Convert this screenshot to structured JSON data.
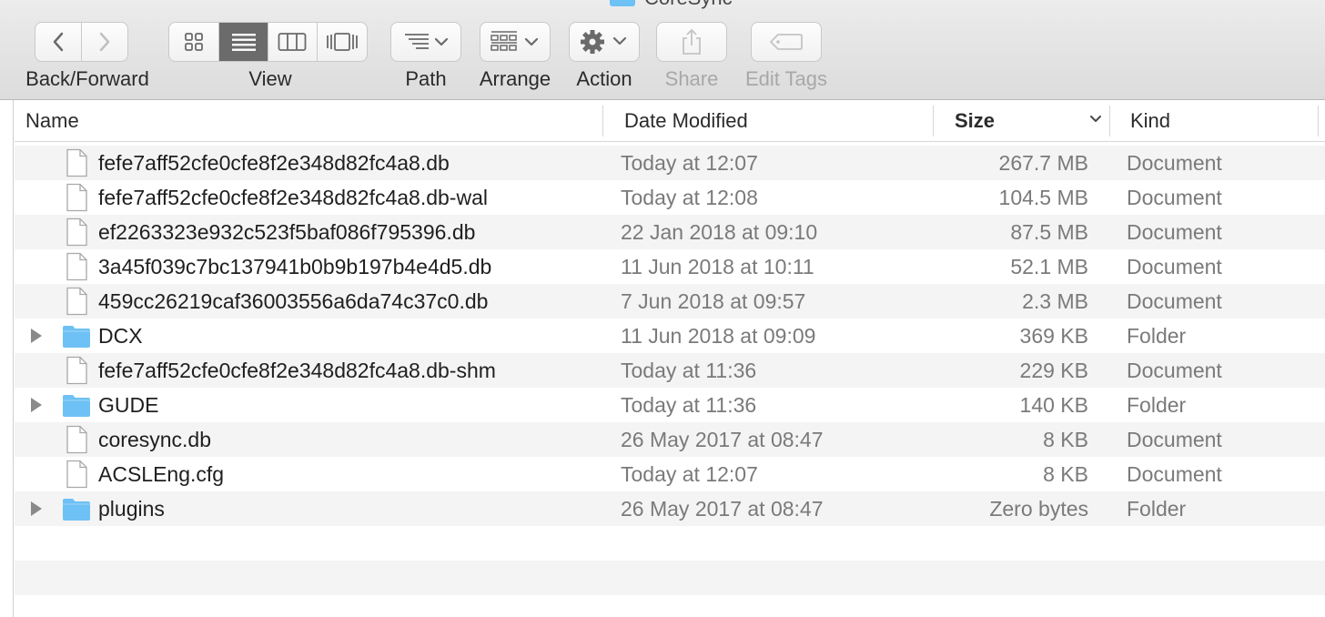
{
  "window": {
    "title": "CoreSync"
  },
  "toolbar": {
    "back_forward_label": "Back/Forward",
    "view_label": "View",
    "path_label": "Path",
    "arrange_label": "Arrange",
    "action_label": "Action",
    "share_label": "Share",
    "edit_tags_label": "Edit Tags",
    "active_view": "list"
  },
  "columns": {
    "name": "Name",
    "date_modified": "Date Modified",
    "size": "Size",
    "kind": "Kind",
    "sorted_by": "size",
    "sort_direction": "descending"
  },
  "files": [
    {
      "name": "fefe7aff52cfe0cfe8f2e348d82fc4a8.db",
      "date": "Today at 12:07",
      "size": "267.7 MB",
      "kind": "Document",
      "type": "file"
    },
    {
      "name": "fefe7aff52cfe0cfe8f2e348d82fc4a8.db-wal",
      "date": "Today at 12:08",
      "size": "104.5 MB",
      "kind": "Document",
      "type": "file"
    },
    {
      "name": "ef2263323e932c523f5baf086f795396.db",
      "date": "22 Jan 2018 at 09:10",
      "size": "87.5 MB",
      "kind": "Document",
      "type": "file"
    },
    {
      "name": "3a45f039c7bc137941b0b9b197b4e4d5.db",
      "date": "11 Jun 2018 at 10:11",
      "size": "52.1 MB",
      "kind": "Document",
      "type": "file"
    },
    {
      "name": "459cc26219caf36003556a6da74c37c0.db",
      "date": "7 Jun 2018 at 09:57",
      "size": "2.3 MB",
      "kind": "Document",
      "type": "file"
    },
    {
      "name": "DCX",
      "date": "11 Jun 2018 at 09:09",
      "size": "369 KB",
      "kind": "Folder",
      "type": "folder"
    },
    {
      "name": "fefe7aff52cfe0cfe8f2e348d82fc4a8.db-shm",
      "date": "Today at 11:36",
      "size": "229 KB",
      "kind": "Document",
      "type": "file"
    },
    {
      "name": "GUDE",
      "date": "Today at 11:36",
      "size": "140 KB",
      "kind": "Folder",
      "type": "folder"
    },
    {
      "name": "coresync.db",
      "date": "26 May 2017 at 08:47",
      "size": "8 KB",
      "kind": "Document",
      "type": "file"
    },
    {
      "name": "ACSLEng.cfg",
      "date": "Today at 12:07",
      "size": "8 KB",
      "kind": "Document",
      "type": "file"
    },
    {
      "name": "plugins",
      "date": "26 May 2017 at 08:47",
      "size": "Zero bytes",
      "kind": "Folder",
      "type": "folder"
    }
  ],
  "colors": {
    "folder": "#6ec1f5",
    "active_segment": "#6b6b6b",
    "alt_row": "#f4f4f4"
  }
}
